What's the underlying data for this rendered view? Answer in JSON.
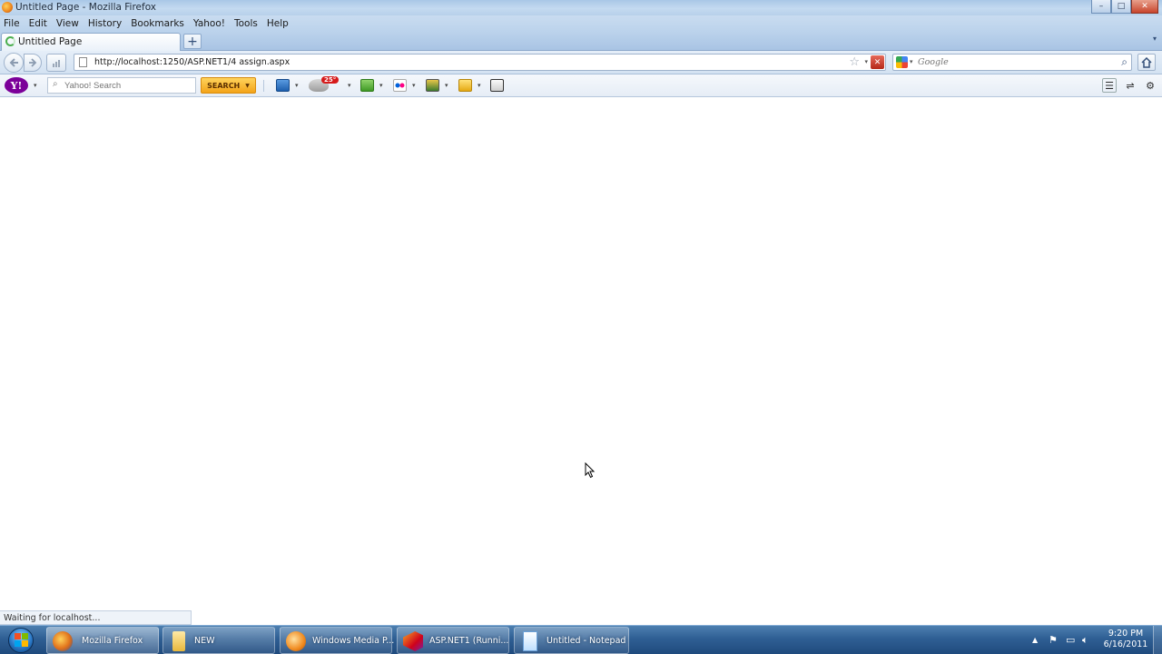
{
  "window": {
    "title": "Untitled Page - Mozilla Firefox",
    "controls": {
      "minimize": "–",
      "maximize": "□",
      "close": "✕"
    }
  },
  "menu": {
    "items": [
      "File",
      "Edit",
      "View",
      "History",
      "Bookmarks",
      "Yahoo!",
      "Tools",
      "Help"
    ]
  },
  "tabs": {
    "active_tab_label": "Untitled Page",
    "new_tab_symbol": "+",
    "tab_list_symbol": "▾"
  },
  "nav": {
    "url": "http://localhost:1250/ASP.NET1/4 assign.aspx",
    "stop_symbol": "✕",
    "search_placeholder": "Google",
    "search_engine_icon": "google-icon"
  },
  "yahoo_toolbar": {
    "logo_text": "Y!",
    "search_placeholder": "Yahoo! Search",
    "search_button": "SEARCH",
    "badge": "25°",
    "tool_icons": [
      "mail-icon",
      "weather-icon",
      "finance-icon",
      "flickr-icon",
      "games-icon",
      "news-icon",
      "screen-icon"
    ]
  },
  "status": {
    "text": "Waiting for localhost..."
  },
  "taskbar": {
    "items": [
      {
        "label": "Mozilla Firefox",
        "icon": "firefox-icon",
        "active": true
      },
      {
        "label": "NEW",
        "icon": "folder-icon",
        "active": false
      },
      {
        "label": "Windows Media P...",
        "icon": "media-player-icon",
        "active": false
      },
      {
        "label": "ASP.NET1 (Runni...",
        "icon": "visual-studio-icon",
        "active": false
      },
      {
        "label": "Untitled - Notepad",
        "icon": "notepad-icon",
        "active": false
      }
    ],
    "clock_time": "9:20 PM",
    "clock_date": "6/16/2011"
  },
  "colors": {
    "taskbar": "#2f5f94",
    "yahoo_purple": "#7b0099",
    "yahoo_search_button": "#f3a319",
    "stop_red": "#c8452c"
  }
}
